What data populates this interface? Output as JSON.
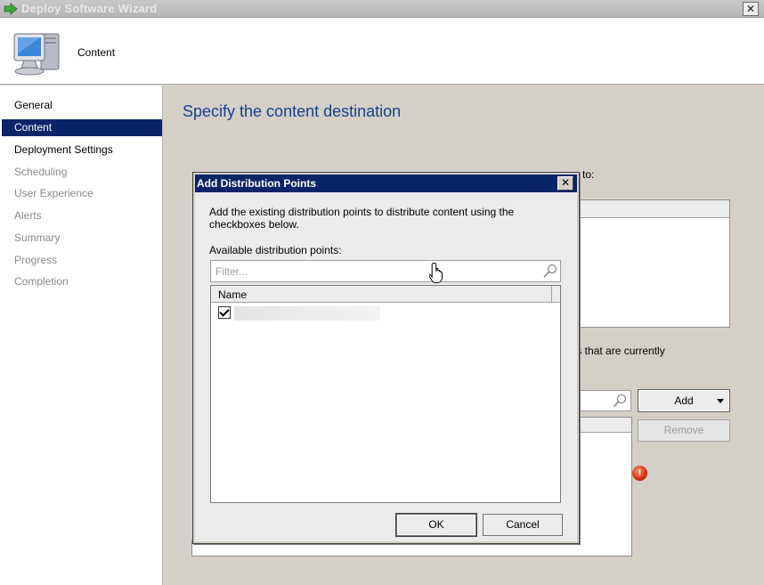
{
  "window": {
    "title": "Deploy Software Wizard",
    "close_glyph": "✕"
  },
  "header": {
    "title": "Content",
    "icon": "computer-monitor-icon"
  },
  "nav": {
    "items": [
      {
        "label": "General",
        "state": "done"
      },
      {
        "label": "Content",
        "state": "active"
      },
      {
        "label": "Deployment Settings",
        "state": "done"
      },
      {
        "label": "Scheduling",
        "state": "pending"
      },
      {
        "label": "User Experience",
        "state": "pending"
      },
      {
        "label": "Alerts",
        "state": "pending"
      },
      {
        "label": "Summary",
        "state": "pending"
      },
      {
        "label": "Progress",
        "state": "pending"
      },
      {
        "label": "Completion",
        "state": "pending"
      }
    ]
  },
  "main": {
    "heading": "Specify the content destination",
    "partial_text_1": "to:",
    "partial_text_2": "ups that are currently",
    "add_label": "Add",
    "remove_label": "Remove",
    "warning_glyph": "!"
  },
  "dialog": {
    "title": "Add Distribution Points",
    "close_glyph": "✕",
    "description": "Add the existing distribution points to distribute content using the checkboxes below.",
    "available_label": "Available distribution points:",
    "filter_placeholder": "Filter...",
    "column_name": "Name",
    "ok_label": "OK",
    "cancel_label": "Cancel"
  },
  "colors": {
    "accent": "#0a246a",
    "heading": "#1a3f8a",
    "error": "#d2300f"
  }
}
